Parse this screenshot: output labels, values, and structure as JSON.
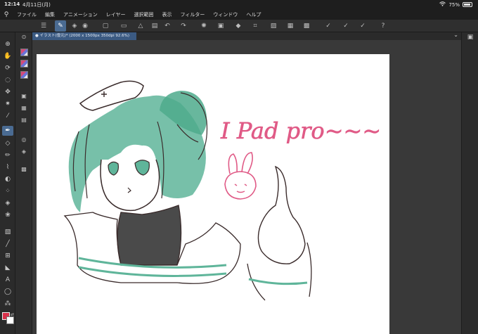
{
  "status": {
    "time": "12:14",
    "date": "4月11日(月)",
    "battery": "75%"
  },
  "menu": {
    "items": [
      "ファイル",
      "編集",
      "アニメーション",
      "レイヤー",
      "選択範囲",
      "表示",
      "フィルター",
      "ウィンドウ",
      "ヘルプ"
    ]
  },
  "canvas": {
    "tab_label": "● イラスト(復元)* (2000 x 1500px 350dpi 92.6%)",
    "drawing_text": "I Pad pro~~~"
  },
  "colors": {
    "main": "#d9304a",
    "sub": "#ffffff",
    "accent": "#4a6b92",
    "tab": "#3b5a82"
  },
  "icons": {
    "command_bar": [
      "menu-icon",
      "pen-tool-icon",
      "layer-icon",
      "new-icon",
      "open-icon",
      "save-icon",
      "undo-icon",
      "redo-icon",
      "loading-icon",
      "copy-icon",
      "fill-icon",
      "crop-icon",
      "transform-icon",
      "check-icon",
      "brush-check-icon",
      "ruler-check-icon",
      "help-icon"
    ],
    "tools": [
      "zoom-icon",
      "hand-icon",
      "rotate-icon",
      "lasso-icon",
      "move-icon",
      "magic-wand-icon",
      "eyedropper-icon",
      "pen-icon",
      "eraser-icon",
      "pencil-icon",
      "brush-icon",
      "blend-icon",
      "fill-bucket-icon",
      "gradient-icon",
      "shape-icon",
      "line-icon",
      "frame-icon",
      "ruler-icon",
      "text-icon",
      "balloon-icon",
      "correction-icon"
    ]
  }
}
